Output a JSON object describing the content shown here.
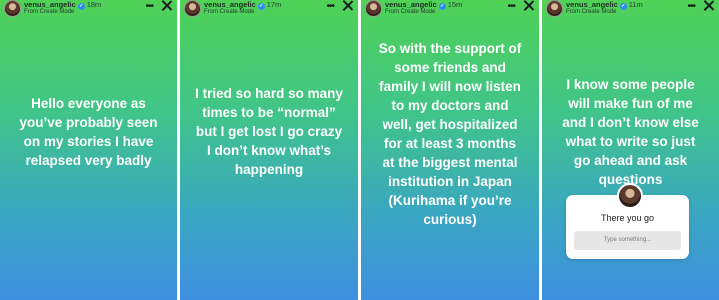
{
  "stories": [
    {
      "username": "venus_angelic",
      "verified_mark": "✓",
      "time": "18m",
      "subtitle": "From Create Mode",
      "more": "•••",
      "text": "Hello everyone as\nyou’ve probably seen\non my stories I have\nrelapsed very badly"
    },
    {
      "username": "venus_angelic",
      "verified_mark": "✓",
      "time": "17m",
      "subtitle": "From Create Mode",
      "more": "•••",
      "text": "I tried so hard so many\ntimes to be “normal”\nbut I get lost I go crazy\nI don’t know what’s\nhappening"
    },
    {
      "username": "venus_angelic",
      "verified_mark": "✓",
      "time": "15m",
      "subtitle": "From Create Mode",
      "more": "•••",
      "text": "So with the support of\nsome friends and\nfamily I will now listen\nto my doctors and\nwell, get hospitalized\nfor at least 3 months\nat the biggest mental\ninstitution in Japan\n(Kurihama if you’re\ncurious)"
    },
    {
      "username": "venus_angelic",
      "verified_mark": "✓",
      "time": "11m",
      "subtitle": "From Create Mode",
      "more": "•••",
      "text": "I know some people\nwill make fun of me\nand I don’t know else\nwhat to write so just\ngo ahead and ask\nquestions",
      "question_sticker": {
        "title": "There you go",
        "placeholder": "Type something..."
      }
    }
  ],
  "colors": {
    "gradient_top": "#4fd255",
    "gradient_bottom": "#3f8fe0",
    "text": "#ffffff"
  },
  "icons": [
    "avatar",
    "verified-badge-icon",
    "more-options-icon",
    "close-icon"
  ]
}
